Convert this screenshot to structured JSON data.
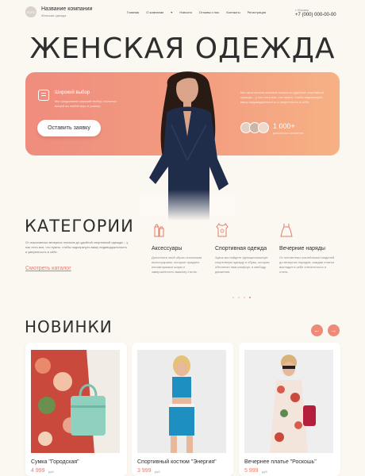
{
  "header": {
    "logo_text": "ЛОГО",
    "company": "Название компании",
    "tagline": "Женская одежда",
    "nav": [
      "Главная",
      "О компании",
      "▾",
      "Новости",
      "Отзывы о нас",
      "Контакты",
      "Регистрация"
    ],
    "city": "г. Москва",
    "phone": "+7 (000) 000-00-00"
  },
  "hero": {
    "title": "ЖЕНСКАЯ ОДЕЖДА",
    "feature_title": "Широкий выбор",
    "feature_text": "Мы предлагаем широкий выбор стильных вещей на любой вкус и размер",
    "cta_label": "Оставить заявку",
    "right_text": "Мы изготовляем женские платья из удобной спортивной одежды – у нас есть все, что нужно, чтобы подчеркнуть вашу индивидуальность и уверенность в себе.",
    "stat_number": "1 000+",
    "stat_label": "довольных клиентов"
  },
  "categories": {
    "title": "КАТЕГОРИИ",
    "text": "От изысканных вечерних платьев до удобной спортивной одежды – у нас есть все, что нужно, чтобы подчеркнуть вашу индивидуальность и уверенность в себе.",
    "link": "Смотреть каталог",
    "items": [
      {
        "name": "Аксессуары",
        "desc": "Дополните свой образ стильными аксессуарами, которые придают неповторимые шарм и завершенность вашему стилю."
      },
      {
        "name": "Спортивная одежда",
        "desc": "Здесь вы найдете функциональную спортивную одежду и обувь, которая обеспечит вам комфорт и свободу движения."
      },
      {
        "name": "Вечерние наряды",
        "desc": "От элегантных коктейльных моделей до вечерних нарядов, каждая платья выглядит в себе элегантность и стиль."
      }
    ]
  },
  "new_arrivals": {
    "title": "НОВИНКИ",
    "products": [
      {
        "name": "Сумка \"Городская\"",
        "price": "4 999",
        "currency": "руб."
      },
      {
        "name": "Спортивный костюм \"Энергия\"",
        "price": "3 999",
        "currency": "руб."
      },
      {
        "name": "Вечернее платье \"Роскошь\"",
        "price": "5 999",
        "currency": "руб."
      }
    ]
  },
  "colors": {
    "accent": "#e37d6a",
    "hero_gradient_start": "#ef8c7e",
    "hero_gradient_end": "#f6b184",
    "background": "#fbf7f1"
  }
}
